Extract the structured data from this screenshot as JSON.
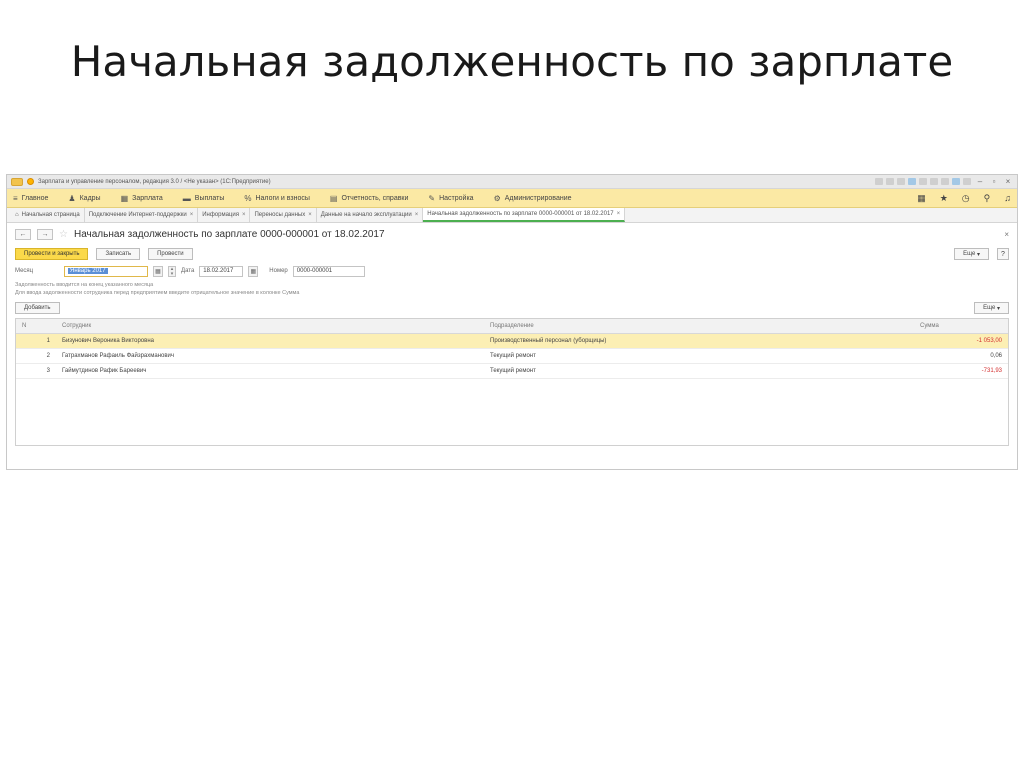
{
  "slide": {
    "title": "Начальная задолженность по зарплате"
  },
  "app": {
    "window_title": "Зарплата и управление персоналом, редакция 3.0 / <Не указан> (1С:Предприятие)",
    "menu": [
      {
        "icon": "≡",
        "label": "Главное"
      },
      {
        "icon": "♟",
        "label": "Кадры"
      },
      {
        "icon": "▦",
        "label": "Зарплата"
      },
      {
        "icon": "▬",
        "label": "Выплаты"
      },
      {
        "icon": "%",
        "label": "Налоги и взносы"
      },
      {
        "icon": "▤",
        "label": "Отчетность, справки"
      },
      {
        "icon": "✎",
        "label": "Настройка"
      },
      {
        "icon": "⚙",
        "label": "Администрирование"
      }
    ],
    "tabs": [
      {
        "label": "Начальная страница",
        "icon": "⌂",
        "closable": false
      },
      {
        "label": "Подключение Интернет-поддержки",
        "closable": true
      },
      {
        "label": "Информация",
        "closable": true
      },
      {
        "label": "Переносы данных",
        "closable": true
      },
      {
        "label": "Данные на начало эксплуатации",
        "closable": true
      },
      {
        "label": "Начальная задолженность по зарплате 0000-000001 от 18.02.2017",
        "closable": true,
        "active": true
      }
    ]
  },
  "document": {
    "title": "Начальная задолженность по зарплате 0000-000001 от 18.02.2017",
    "buttons": {
      "post_close": "Провести и закрыть",
      "save": "Записать",
      "post": "Провести",
      "more": "Еще",
      "help": "?"
    },
    "fields": {
      "month_label": "Месяц",
      "month_value": "Январь 2017",
      "date_label": "Дата",
      "date_value": "18.02.2017",
      "number_label": "Номер",
      "number_value": "0000-000001"
    },
    "hints": [
      "Задолженность вводится на конец указанного месяца",
      "Для ввода задолженности сотрудника перед предприятием введите отрицательное значение в колонке Сумма"
    ],
    "table_buttons": {
      "add": "Добавить",
      "more": "Еще"
    },
    "table": {
      "columns": [
        "N",
        "Сотрудник",
        "Подразделение",
        "Сумма"
      ],
      "rows": [
        {
          "n": "1",
          "employee": "Бизунович Вероника Викторовна",
          "department": "Производственный персонал (уборщицы)",
          "sum": "-1 053,00",
          "negative": true,
          "selected": true
        },
        {
          "n": "2",
          "employee": "Гатрахманов Рафаиль Файзрахманович",
          "department": "Текущий ремонт",
          "sum": "0,06",
          "negative": false,
          "selected": false
        },
        {
          "n": "3",
          "employee": "Гаймутдинов Рафик Бареевич",
          "department": "Текущий ремонт",
          "sum": "-731,93",
          "negative": true,
          "selected": false
        }
      ]
    }
  },
  "colors": {
    "menu_bg": "#fbe9a4",
    "primary_button": "#fbd94a",
    "selected_row": "#fcefb4",
    "negative": "#d32f2f",
    "active_tab_underline": "#4caf50"
  }
}
